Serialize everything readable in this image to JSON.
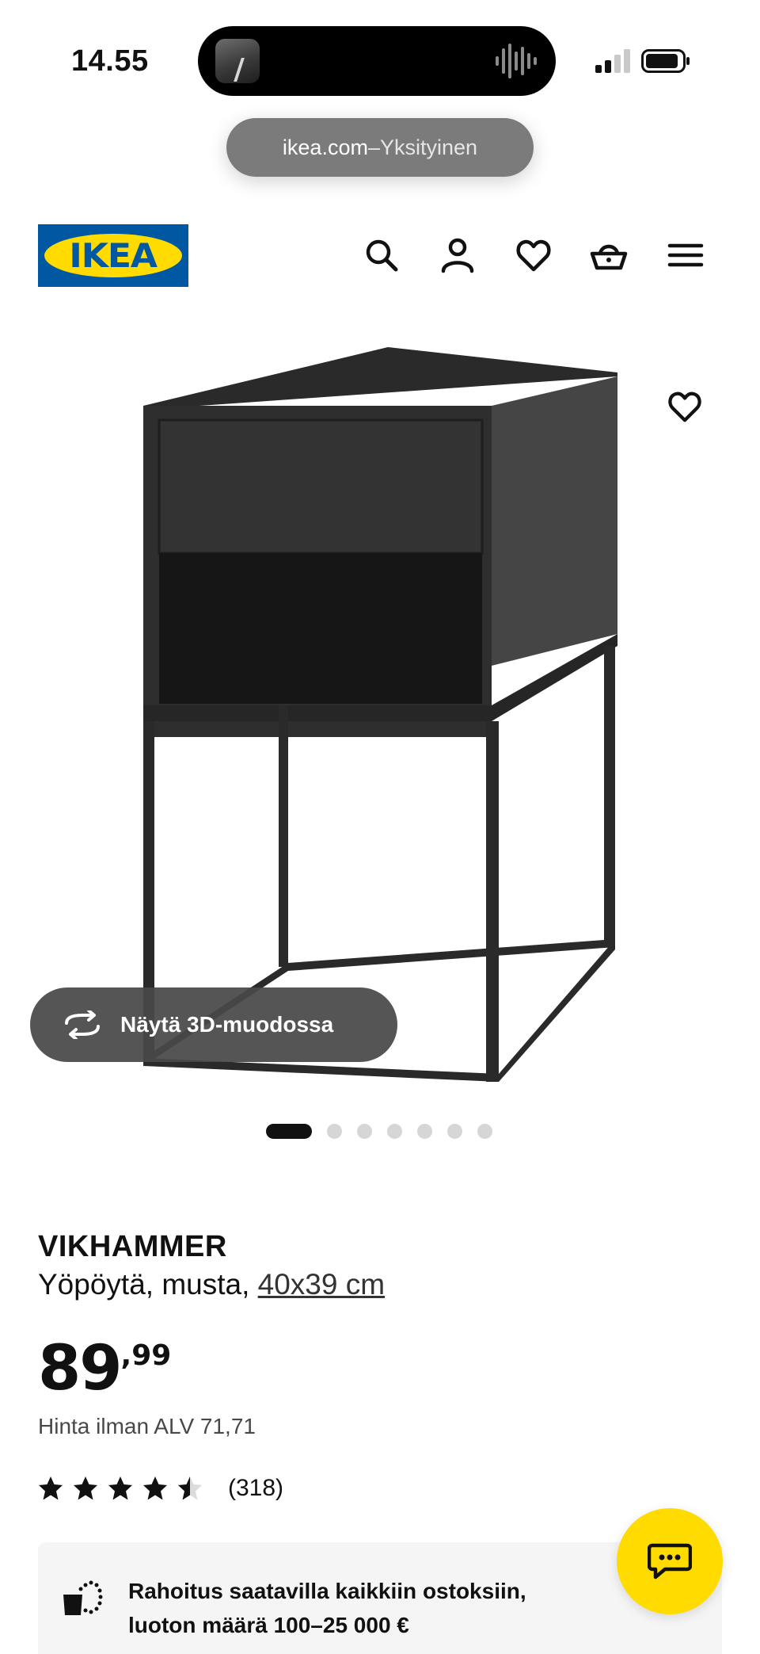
{
  "status_bar": {
    "time": "14.55"
  },
  "browser": {
    "domain": "ikea.com",
    "separator": " – ",
    "mode": "Yksityinen"
  },
  "header": {
    "logo_text": "IKEA",
    "icons": [
      "search-icon",
      "profile-icon",
      "favourites-heart-icon",
      "shopping-basket-icon",
      "hamburger-menu-icon"
    ]
  },
  "gallery": {
    "view_3d_label": "Näytä 3D-muodossa",
    "image_count": 7,
    "active_index": 0
  },
  "product": {
    "name": "VIKHAMMER",
    "description": "Yöpöytä, musta, ",
    "size": "40x39 cm",
    "price_integer": "89",
    "price_decimal": ",99",
    "price_excl_vat": "Hinta ilman ALV 71,71",
    "rating_value": 4.5,
    "rating_count": "(318)"
  },
  "finance": {
    "line1": "Rahoitus saatavilla kaikkiin ostoksiin,",
    "line2": "luoton määrä 100–25 000 €"
  },
  "colors": {
    "ikea_blue": "#0058a3",
    "ikea_yellow": "#ffdb00",
    "text": "#111111"
  }
}
